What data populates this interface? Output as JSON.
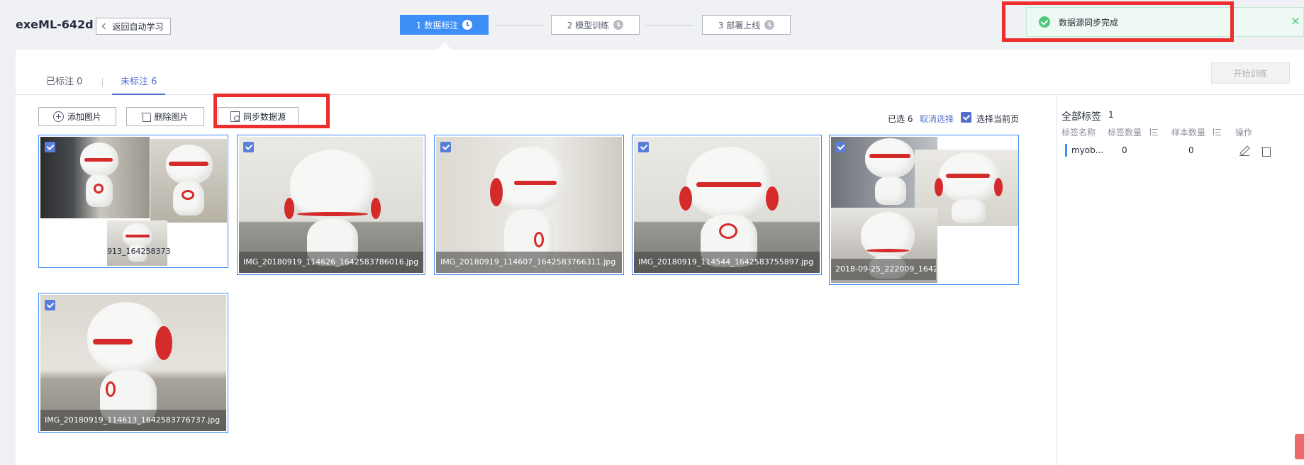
{
  "header": {
    "app_title": "exeML-642d",
    "back_label": "返回自动学习"
  },
  "steps": [
    {
      "label": "1 数据标注",
      "state": "active"
    },
    {
      "label": "2 模型训练",
      "state": "inactive"
    },
    {
      "label": "3 部署上线",
      "state": "inactive"
    }
  ],
  "toast": {
    "message": "数据源同步完成",
    "close_glyph": "×",
    "status": "success",
    "icon": "check-circle-icon"
  },
  "tabs": [
    {
      "label": "已标注 0",
      "active": false
    },
    {
      "label": "未标注 6",
      "active": true
    }
  ],
  "start_training_label": "开始训练",
  "toolbar": {
    "add_label": "添加图片",
    "delete_label": "删除图片",
    "sync_label": "同步数据源"
  },
  "selection": {
    "selected_text": "已选 6",
    "cancel_label": "取消选择",
    "select_page_label": "选择当前页"
  },
  "images": [
    {
      "name": "913_164258373",
      "checked": true
    },
    {
      "name": "IMG_20180919_114626_1642583786016.jpg",
      "checked": true
    },
    {
      "name": "IMG_20180919_114607_1642583766311.jpg",
      "checked": true
    },
    {
      "name": "IMG_20180919_114544_1642583755897.jpg",
      "checked": true
    },
    {
      "name": "2018-09-25_222009_1642",
      "checked": true
    },
    {
      "name": "IMG_20180919_114613_1642583776737.jpg",
      "checked": true
    }
  ],
  "labels_panel": {
    "title": "全部标签",
    "count": "1",
    "columns": {
      "name": "标签名称",
      "label_count": "标签数量",
      "sample_count": "样本数量",
      "actions": "操作"
    },
    "rows": [
      {
        "name": "myob...",
        "label_count": "0",
        "sample_count": "0",
        "color": "#3e8ef7"
      }
    ]
  },
  "colors": {
    "primary": "#3e8ef7",
    "link": "#526ecc",
    "success": "#50c97f",
    "highlight": "#ec2e2e"
  }
}
